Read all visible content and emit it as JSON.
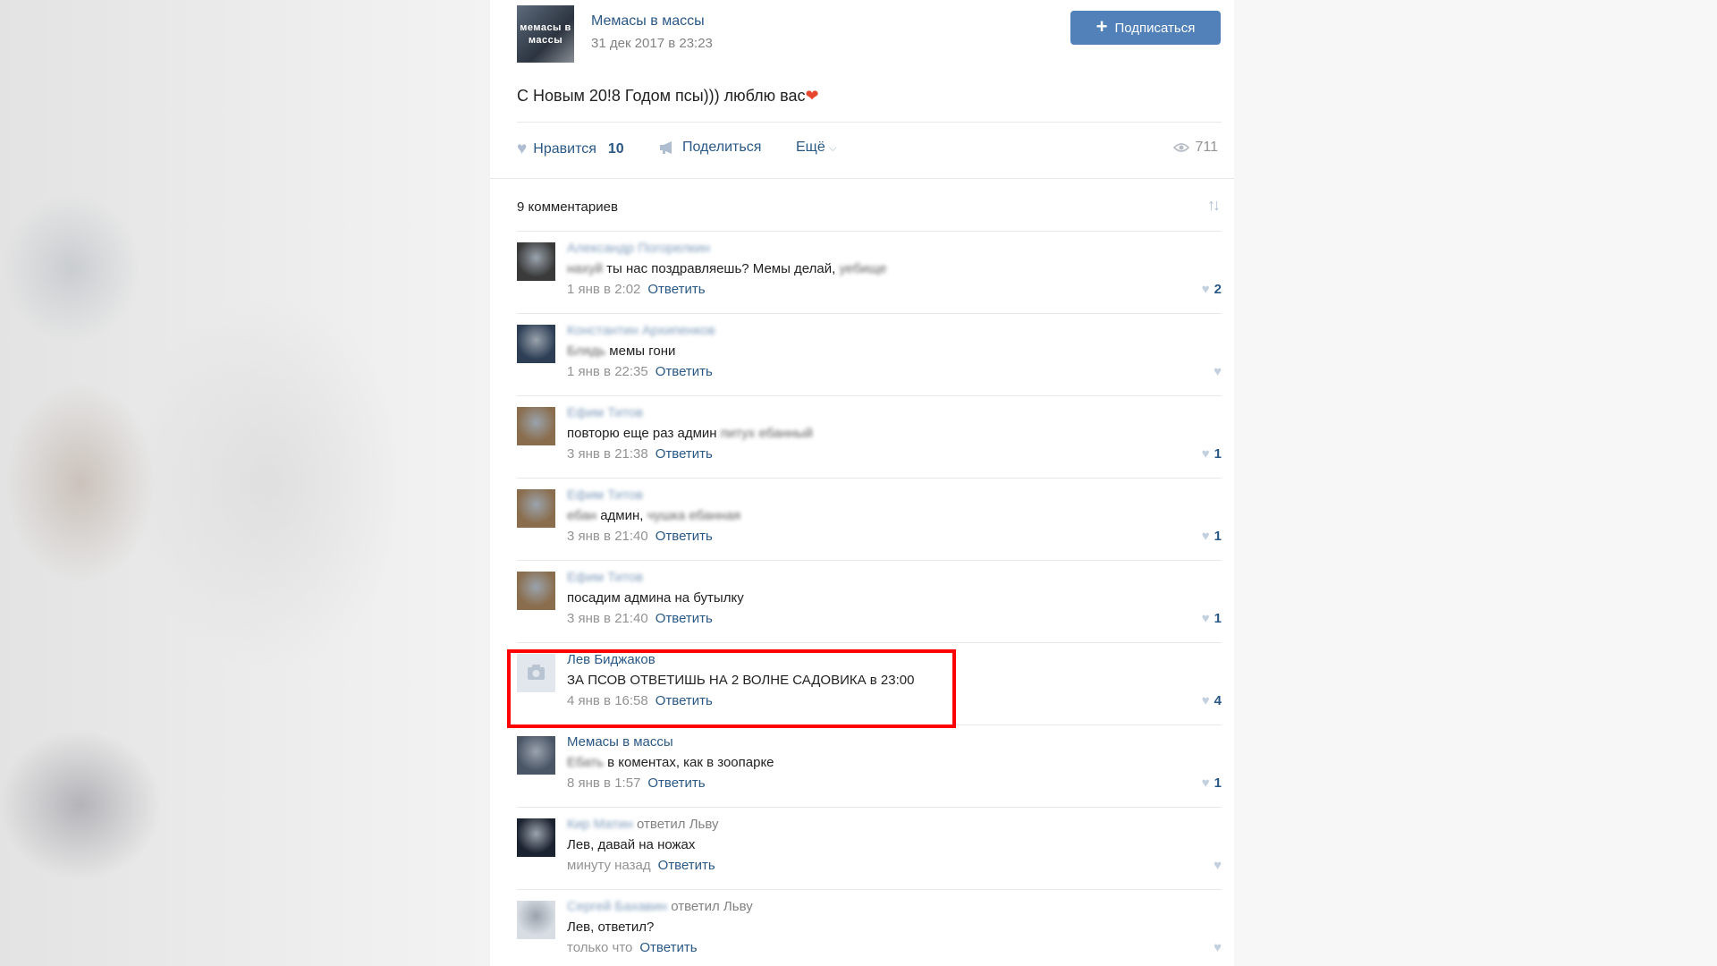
{
  "post": {
    "group_name": "Мемасы в массы",
    "date": "31 дек 2017 в 23:23",
    "subscribe_label": "Подписаться",
    "avatar_text": "мемасы в массы",
    "text": "С Новым 20!8 Годом псы))) люблю вас",
    "emoji": "❤"
  },
  "actions": {
    "like_label": "Нравится",
    "like_count": "10",
    "share_label": "Поделиться",
    "more_label": "Ещё",
    "views": "711"
  },
  "comments_header": {
    "title": "9 комментариев"
  },
  "comments": [
    {
      "author": "Александр Погорелкин",
      "author_blurred": true,
      "reply_to": "",
      "text_blur_pre": "нахуй",
      "text": " ты нас поздравляешь? Мемы делай, ",
      "text_blur_post": "уебище",
      "time": "1 янв в 2:02",
      "reply": "Ответить",
      "likes": "2",
      "avatar": "#3a3a3a"
    },
    {
      "author": "Константин Архипенков",
      "author_blurred": true,
      "reply_to": "",
      "text_blur_pre": "Блядь",
      "text": " мемы гони",
      "text_blur_post": "",
      "time": "1 янв в 22:35",
      "reply": "Ответить",
      "likes": "",
      "avatar": "#2d3e55"
    },
    {
      "author": "Ефим Титов",
      "author_blurred": true,
      "reply_to": "",
      "text_blur_pre": "",
      "text": "повторю еще раз админ ",
      "text_blur_post": "питух ебанный",
      "time": "3 янв в 21:38",
      "reply": "Ответить",
      "likes": "1",
      "avatar": "#8a6d4c"
    },
    {
      "author": "Ефим Титов",
      "author_blurred": true,
      "reply_to": "",
      "text_blur_pre": "ебан",
      "text": " админ, ",
      "text_blur_post": "чушка ебанная",
      "time": "3 янв в 21:40",
      "reply": "Ответить",
      "likes": "1",
      "avatar": "#8a6d4c"
    },
    {
      "author": "Ефим Титов",
      "author_blurred": true,
      "reply_to": "",
      "text_blur_pre": "",
      "text": "посадим админа на бутылку",
      "text_blur_post": "",
      "time": "3 янв в 21:40",
      "reply": "Ответить",
      "likes": "1",
      "avatar": "#8a6d4c"
    },
    {
      "author": "Лев Биджаков",
      "author_blurred": false,
      "reply_to": "",
      "text_blur_pre": "",
      "text": "ЗА ПСОВ ОТВЕТИШЬ НА 2 ВОЛНЕ САДОВИКА в 23:00",
      "text_blur_post": "",
      "time": "4 янв в 16:58",
      "reply": "Ответить",
      "likes": "4",
      "avatar": "camera"
    },
    {
      "author": "Мемасы в массы",
      "author_blurred": false,
      "reply_to": "",
      "text_blur_pre": "Ебать",
      "text": " в коментах, как в зоопарке",
      "text_blur_post": "",
      "time": "8 янв в 1:57",
      "reply": "Ответить",
      "likes": "1",
      "avatar": "#4a5566"
    },
    {
      "author": "Кир Матин",
      "author_blurred": true,
      "reply_to": "ответил Льву",
      "text_blur_pre": "",
      "text": "Лев, давай на ножах",
      "text_blur_post": "",
      "time": "минуту назад",
      "reply": "Ответить",
      "likes": "",
      "avatar": "#1c2330"
    },
    {
      "author": "Сергей Бахавин",
      "author_blurred": true,
      "reply_to": "ответил Льву",
      "text_blur_pre": "",
      "text": "Лев, ответил?",
      "text_blur_post": "",
      "time": "только что",
      "reply": "Ответить",
      "likes": "",
      "avatar": "#d8dde3"
    }
  ],
  "colors": {
    "link": "#2a5885",
    "button": "#5181b8",
    "highlight": "#ff0000",
    "muted": "#939393"
  },
  "icons": [
    "plus-icon",
    "heart-icon",
    "megaphone-icon",
    "chevron-down-icon",
    "eye-icon",
    "sort-icon",
    "camera-icon"
  ]
}
